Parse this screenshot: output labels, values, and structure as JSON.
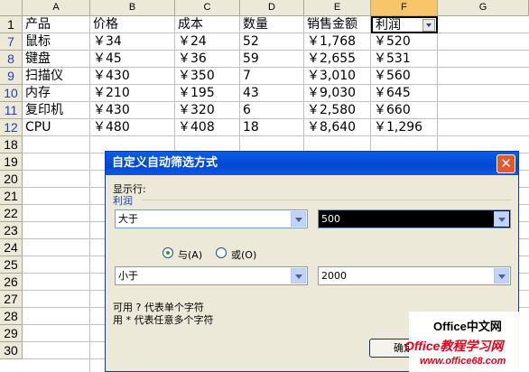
{
  "columns": [
    "A",
    "B",
    "C",
    "D",
    "E",
    "F",
    "G"
  ],
  "rows": [
    "1",
    "7",
    "8",
    "9",
    "10",
    "11",
    "12",
    "18",
    "19",
    "20",
    "21",
    "22",
    "23",
    "24",
    "25",
    "26",
    "27",
    "28",
    "29",
    "30"
  ],
  "header_row": [
    "产品",
    "价格",
    "成本",
    "数量",
    "销售金额",
    "利润"
  ],
  "data_rows": [
    [
      "鼠标",
      "￥34",
      "￥24",
      "52",
      "￥1,768",
      "￥520"
    ],
    [
      "键盘",
      "￥45",
      "￥36",
      "59",
      "￥2,655",
      "￥531"
    ],
    [
      "扫描仪",
      "￥430",
      "￥350",
      "7",
      "￥3,010",
      "￥560"
    ],
    [
      "内存",
      "￥210",
      "￥195",
      "43",
      "￥9,030",
      "￥645"
    ],
    [
      "复印机",
      "￥430",
      "￥320",
      "6",
      "￥2,580",
      "￥660"
    ],
    [
      "CPU",
      "￥480",
      "￥408",
      "18",
      "￥8,640",
      "￥1,296"
    ]
  ],
  "dialog": {
    "title": "自定义自动筛选方式",
    "close": "✕",
    "show_rows_label": "显示行:",
    "field_name": "利润",
    "cond1_op": "大于",
    "cond1_value": "500",
    "and_label": "与(A)",
    "or_label": "或(O)",
    "cond2_op": "小于",
    "cond2_value": "2000",
    "hint1": "可用 ? 代表单个字符",
    "hint2": "用 * 代表任意多个字符",
    "ok_label": "确定"
  },
  "watermark": {
    "line1": "Office中文网",
    "line2": "Office教程学习网",
    "line3": "www.office68.com"
  }
}
